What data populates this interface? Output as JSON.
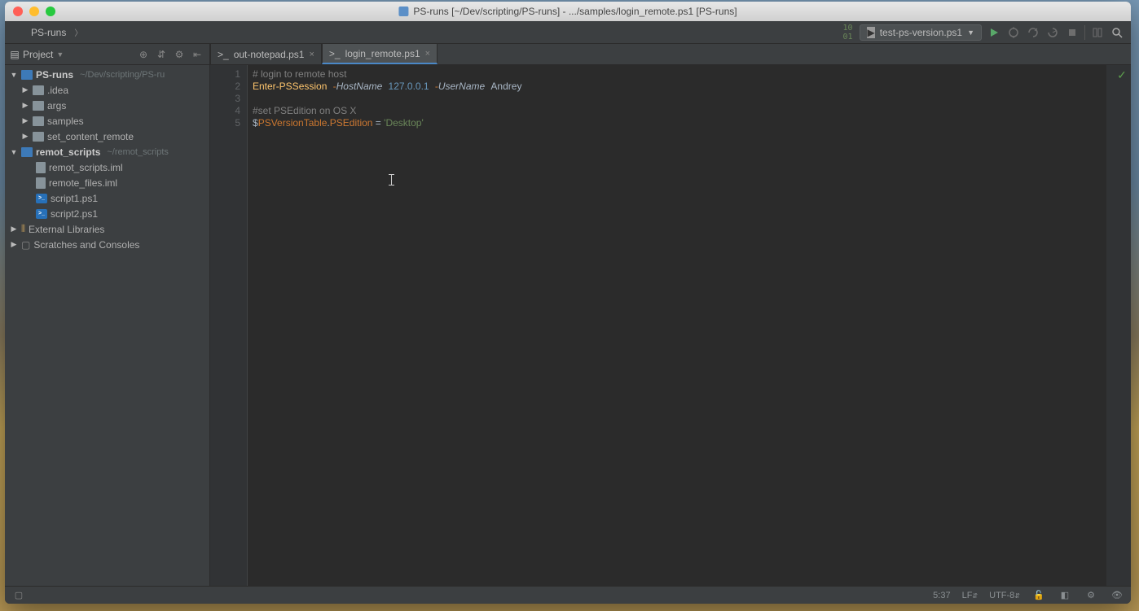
{
  "title": "PS-runs [~/Dev/scripting/PS-runs] - .../samples/login_remote.ps1 [PS-runs]",
  "breadcrumb": {
    "root": "PS-runs"
  },
  "runConfig": {
    "label": "test-ps-version.ps1"
  },
  "projectPanel": {
    "title": "Project"
  },
  "tree": {
    "psruns": {
      "label": "PS-runs",
      "path": "~/Dev/scripting/PS-ru"
    },
    "idea": ".idea",
    "args": "args",
    "samples": "samples",
    "set_content_remote": "set_content_remote",
    "remot_scripts": {
      "label": "remot_scripts",
      "path": "~/remot_scripts"
    },
    "remot_scripts_iml": "remot_scripts.iml",
    "remote_files_iml": "remote_files.iml",
    "script1": "script1.ps1",
    "script2": "script2.ps1",
    "external_libraries": "External Libraries",
    "scratches": "Scratches and Consoles"
  },
  "tabs": [
    {
      "label": "out-notepad.ps1",
      "active": false
    },
    {
      "label": "login_remote.ps1",
      "active": true
    }
  ],
  "gutter": [
    "1",
    "2",
    "3",
    "4",
    "5"
  ],
  "code": {
    "l1_comment": "# login to remote host",
    "l2_cmd": "Enter-PSSession",
    "l2_p1": "-HostName",
    "l2_ip": "127.0.0.1",
    "l2_p2": "-UserName",
    "l2_user": "Andrey",
    "l4_comment": "#set PSEdition on OS X",
    "l5_dollar": "$",
    "l5_var": "PSVersionTable",
    "l5_dot": ".",
    "l5_prop": "PSEdition",
    "l5_eq": " = ",
    "l5_str": "'Desktop'"
  },
  "status": {
    "pos": "5:37",
    "lineend": "LF",
    "encoding": "UTF-8"
  }
}
